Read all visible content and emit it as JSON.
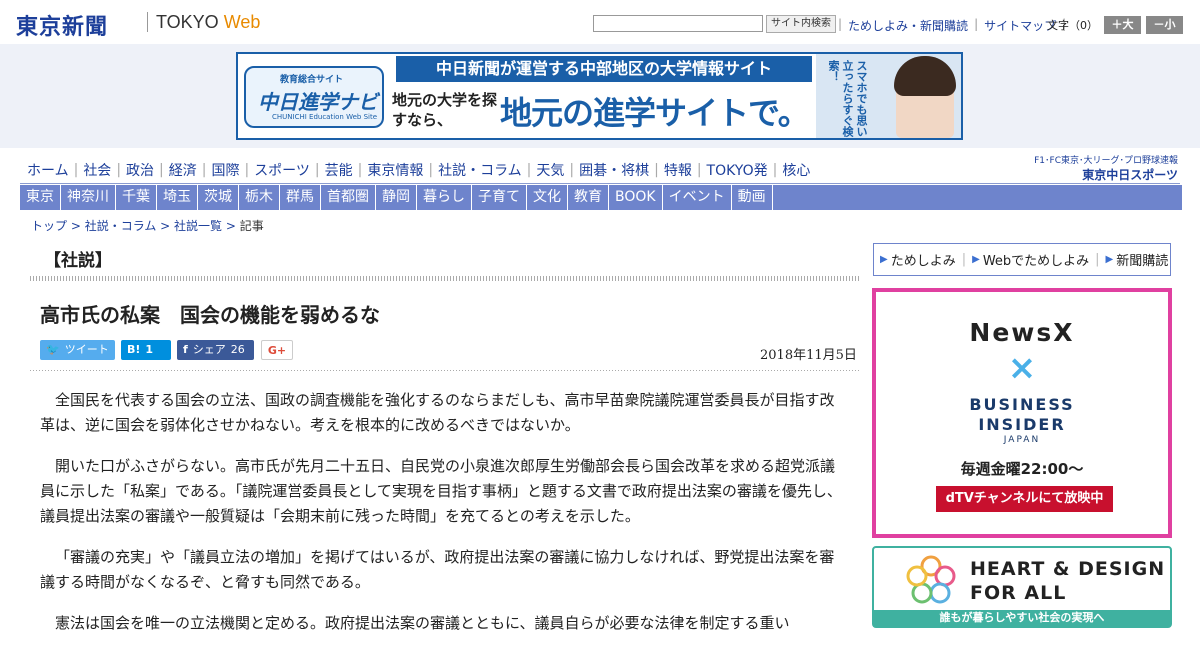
{
  "header": {
    "logo_jp": "東京新聞",
    "logo_tokyo": "TOKYO",
    "logo_web": "Web",
    "search_button": "サイト内検索",
    "links": [
      "ためしよみ・新聞購読",
      "サイトマップ"
    ],
    "font_size_label": "文字（0）",
    "font_larger": "＋大",
    "font_smaller": "－小"
  },
  "ad_banner": {
    "logo_small": "教育総合サイト",
    "logo_big": "中日進学ナビ",
    "logo_sub": "CHUNICHI Education Web Site",
    "headline": "中日新聞が運営する中部地区の大学情報サイト",
    "left_text": "地元の大学を探すなら、",
    "main_text": "地元の進学サイトで。",
    "vertical_text": "スマホでも思い立ったらすぐ検索！"
  },
  "nav_main": [
    "ホーム",
    "社会",
    "政治",
    "経済",
    "国際",
    "スポーツ",
    "芸能",
    "東京情報",
    "社説・コラム",
    "天気",
    "囲碁・将棋",
    "特報",
    "TOKYO発",
    "核心"
  ],
  "nav_right": {
    "line1": "F1･FC東京･大リーグ･プロ野球速報",
    "line2": "東京中日スポーツ"
  },
  "nav_regional": [
    "東京",
    "神奈川",
    "千葉",
    "埼玉",
    "茨城",
    "栃木",
    "群馬",
    "首都圏",
    "静岡",
    "暮らし",
    "子育て",
    "文化",
    "教育",
    "BOOK",
    "イベント",
    "動画"
  ],
  "breadcrumb": {
    "items": [
      "トップ",
      "社説・コラム",
      "社説一覧"
    ],
    "current": "記事",
    "sep": " > "
  },
  "article": {
    "section": "【社説】",
    "headline": "高市氏の私案　国会の機能を弱めるな",
    "share": {
      "tweet": "ツイート",
      "hatena": "B!",
      "hatena_count": "1",
      "facebook": "シェア",
      "facebook_count": "26",
      "gplus": "G+"
    },
    "date": "2018年11月5日",
    "paragraphs": [
      "全国民を代表する国会の立法、国政の調査機能を強化するのならまだしも、高市早苗衆院議院運営委員長が目指す改革は、逆に国会を弱体化させかねない。考えを根本的に改めるべきではないか。",
      "開いた口がふさがらない。高市氏が先月二十五日、自民党の小泉進次郎厚生労働部会長ら国会改革を求める超党派議員に示した「私案」である。「議院運営委員長として実現を目指す事柄」と題する文書で政府提出法案の審議を優先し、議員提出法案の審議や一般質疑は「会期末前に残った時間」を充てるとの考えを示した。",
      "「審議の充実」や「議員立法の増加」を掲げてはいるが、政府提出法案の審議に協力しなければ、野党提出法案を審議する時間がなくなるぞ、と脅すも同然である。",
      "憲法は国会を唯一の立法機関と定める。政府提出法案の審議とともに、議員自らが必要な法律を制定する重い"
    ]
  },
  "sidebar": {
    "links": [
      "ためしよみ",
      "Webでためしよみ",
      "新聞購読"
    ],
    "news_ad": {
      "newsx": "NewsX",
      "cross": "×",
      "bi_line1": "BUSINESS",
      "bi_line2": "INSIDER",
      "bi_line3": "JAPAN",
      "weekly": "毎週金曜22:00～",
      "dtv": "dTVチャンネルにて放映中"
    },
    "heart_ad": {
      "line1": "HEART & DESIGN",
      "line2": "FOR ALL",
      "bar": "誰もが暮らしやすい社会の実現へ"
    }
  },
  "colors": {
    "brand_blue": "#1d3f9a",
    "nav_bg": "#6e84cc",
    "ad_blue": "#1a5fa8",
    "dtv_red": "#c8102e",
    "accent_pink": "#e040a0",
    "teal": "#3fb1a0"
  }
}
